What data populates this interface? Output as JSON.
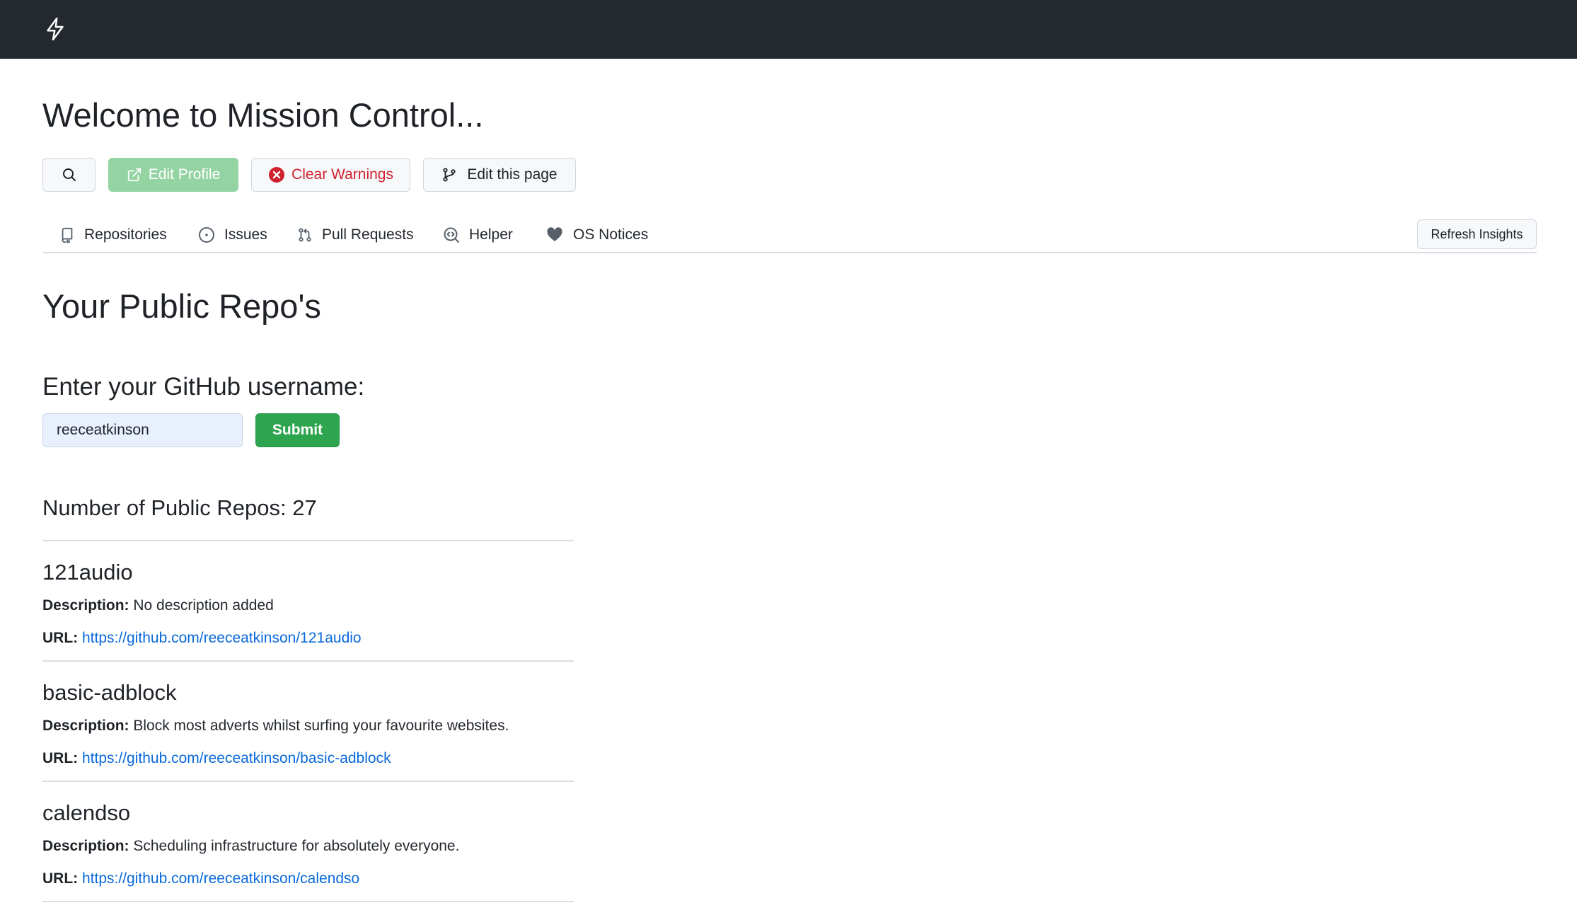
{
  "header": {
    "logo_icon": "zap-icon"
  },
  "page": {
    "title": "Welcome to Mission Control..."
  },
  "toolbar": {
    "search_icon": "search-icon",
    "edit_profile_label": "Edit Profile",
    "clear_warnings_label": "Clear Warnings",
    "edit_page_label": "Edit this page"
  },
  "tabs": [
    {
      "label": "Repositories",
      "icon": "repo-icon"
    },
    {
      "label": "Issues",
      "icon": "issue-icon"
    },
    {
      "label": "Pull Requests",
      "icon": "pull-request-icon"
    },
    {
      "label": "Helper",
      "icon": "code-review-icon"
    },
    {
      "label": "OS Notices",
      "icon": "heart-icon"
    }
  ],
  "refresh_label": "Refresh Insights",
  "section": {
    "title": "Your Public Repo's"
  },
  "form": {
    "label": "Enter your GitHub username:",
    "username_value": "reeceatkinson",
    "submit_label": "Submit"
  },
  "repos": {
    "count_text": "Number of Public Repos: 27",
    "description_label": "Description:",
    "url_label": "URL:",
    "items": [
      {
        "name": "121audio",
        "description": "No description added",
        "url": "https://github.com/reeceatkinson/121audio"
      },
      {
        "name": "basic-adblock",
        "description": "Block most adverts whilst surfing your favourite websites.",
        "url": "https://github.com/reeceatkinson/basic-adblock"
      },
      {
        "name": "calendso",
        "description": "Scheduling infrastructure for absolutely everyone.",
        "url": "https://github.com/reeceatkinson/calendso"
      }
    ]
  },
  "colors": {
    "topbar": "#24292f",
    "edit_profile_bg": "#94d3a2",
    "danger": "#cf222e",
    "submit_bg": "#2da44e",
    "link": "#0969da"
  }
}
